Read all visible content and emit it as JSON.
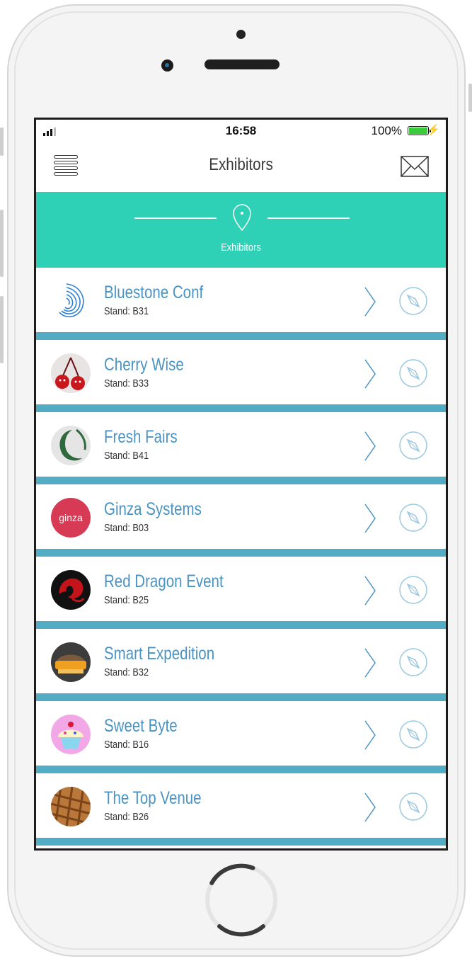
{
  "status_bar": {
    "time": "16:58",
    "battery": "100%"
  },
  "nav": {
    "title": "Exhibitors",
    "menu_icon": "menu-icon",
    "mail_icon": "envelope-icon"
  },
  "hero": {
    "label": "Exhibitors",
    "icon": "location-pin-icon"
  },
  "exhibitors": [
    {
      "name": "Bluestone Conf",
      "stand": "Stand: B31",
      "logo": "bluestone-logo"
    },
    {
      "name": "Cherry Wise",
      "stand": "Stand: B33",
      "logo": "cherry-logo"
    },
    {
      "name": "Fresh Fairs",
      "stand": "Stand: B41",
      "logo": "fresh-fairs-logo"
    },
    {
      "name": "Ginza Systems",
      "stand": "Stand: B03",
      "logo": "ginza-logo",
      "logo_text": "ginza"
    },
    {
      "name": "Red Dragon Event",
      "stand": "Stand: B25",
      "logo": "red-dragon-logo"
    },
    {
      "name": "Smart Expedition",
      "stand": "Stand: B32",
      "logo": "smart-expedition-logo"
    },
    {
      "name": "Sweet Byte",
      "stand": "Stand: B16",
      "logo": "cupcake-logo"
    },
    {
      "name": "The Top Venue",
      "stand": "Stand: B26",
      "logo": "waffle-logo"
    }
  ],
  "colors": {
    "accent": "#2fd1b6",
    "divider": "#52adc4",
    "link": "#4a93c2"
  }
}
